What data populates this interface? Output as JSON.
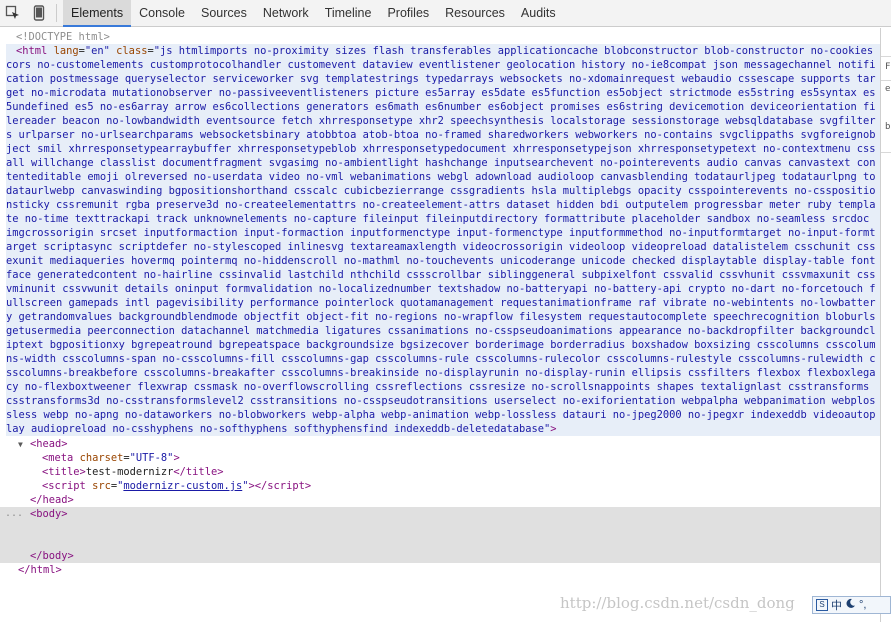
{
  "toolbar": {
    "inspect_icon": "inspect-element-icon",
    "device_icon": "device-mode-icon",
    "tabs": [
      "Elements",
      "Console",
      "Sources",
      "Network",
      "Timeline",
      "Profiles",
      "Resources",
      "Audits"
    ],
    "active_tab": "Elements"
  },
  "dom": {
    "doctype": "<!DOCTYPE html>",
    "html_tag": "html",
    "html_lang_attr": "lang",
    "html_lang_value": "en",
    "html_class_attr": "class",
    "html_class_value": "js htmlimports no-proximity sizes flash transferables applicationcache blobconstructor blob-constructor no-cookies cors no-customelements customprotocolhandler customevent dataview eventlistener geolocation history no-ie8compat json messagechannel notification postmessage queryselector serviceworker svg templatestrings typedarrays websockets no-xdomainrequest webaudio cssescape supports target no-microdata mutationobserver no-passiveeventlisteners picture es5array es5date es5function es5object strictmode es5string es5syntax es5undefined es5 no-es6array arrow es6collections generators es6math es6number es6object promises es6string devicemotion deviceorientation filereader beacon no-lowbandwidth eventsource fetch xhrresponsetype xhr2 speechsynthesis localstorage sessionstorage websqldatabase svgfilters urlparser no-urlsearchparams websocketsbinary atobbtoa atob-btoa no-framed sharedworkers webworkers no-contains svgclippaths svgforeignobject smil xhrresponsetypearraybuffer xhrresponsetypeblob xhrresponsetypedocument xhrresponsetypejson xhrresponsetypetext no-contextmenu cssall willchange classlist documentfragment svgasimg no-ambientlight hashchange inputsearchevent no-pointerevents audio canvas canvastext contenteditable emoji olreversed no-userdata video no-vml webanimations webgl adownload audioloop canvasblending todataurljpeg todataurlpng todataurlwebp canvaswinding bgpositionshorthand csscalc cubicbezierrange cssgradients hsla multiplebgs opacity csspointerevents no-csspositionsticky cssremunit rgba preserve3d no-createelementattrs no-createelement-attrs dataset hidden bdi outputelem progressbar meter ruby template no-time texttrackapi track unknownelements no-capture fileinput fileinputdirectory formattribute placeholder sandbox no-seamless srcdoc imgcrossorigin srcset inputformaction input-formaction inputformenctype input-formenctype inputformmethod no-inputformtarget no-input-formtarget scriptasync scriptdefer no-stylescoped inlinesvg textareamaxlength videocrossorigin videoloop videopreload datalistelem csschunit cssexunit mediaqueries hovermq pointermq no-hiddenscroll no-mathml no-touchevents unicoderange unicode checked displaytable display-table fontface generatedcontent no-hairline cssinvalid lastchild nthchild cssscrollbar siblinggeneral subpixelfont cssvalid cssvhunit cssvmaxunit cssvminunit cssvwunit details oninput formvalidation no-localizednumber textshadow no-batteryapi no-battery-api crypto no-dart no-forcetouch fullscreen gamepads intl pagevisibility performance pointerlock quotamanagement requestanimationframe raf vibrate no-webintents no-lowbattery getrandomvalues backgroundblendmode objectfit object-fit no-regions no-wrapflow filesystem requestautocomplete speechrecognition bloburls getusermedia peerconnection datachannel matchmedia ligatures cssanimations no-csspseudoanimations appearance no-backdropfilter backgroundcliptext bgpositionxy bgrepeatround bgrepeatspace backgroundsize bgsizecover borderimage borderradius boxshadow boxsizing csscolumns csscolumns-width csscolumns-span no-csscolumns-fill csscolumns-gap csscolumns-rule csscolumns-rulecolor csscolumns-rulestyle csscolumns-rulewidth csscolumns-breakbefore csscolumns-breakafter csscolumns-breakinside no-displayrunin no-display-runin ellipsis cssfilters flexbox flexboxlegacy no-flexboxtweener flexwrap cssmask no-overflowscrolling cssreflections cssresize no-scrollsnappoints shapes textalignlast csstransforms csstransforms3d no-csstransformslevel2 csstransitions no-csspseudotransitions userselect no-exiforientation webpalpha webpanimation webplossless webp no-apng no-dataworkers no-blobworkers webp-alpha webp-animation webp-lossless datauri no-jpeg2000 no-jpegxr indexeddb videoautoplay audiopreload no-csshyphens no-softhyphens softhyphensfind indexeddb-deletedatabase",
    "head_tag": "head",
    "meta_tag": "meta",
    "meta_attr": "charset",
    "meta_value": "UTF-8",
    "title_tag": "title",
    "title_text": "test-modernizr",
    "script_tag": "script",
    "script_attr": "src",
    "script_value": "modernizr-custom.js",
    "body_tag": "body",
    "ellipsis": "..."
  },
  "right_panel": {
    "marks": [
      "F",
      "e",
      "b"
    ]
  },
  "watermark": "http://blog.csdn.net/csdn_dong",
  "ime": {
    "input_mode": "中",
    "moon_icon": "moon-icon",
    "punct": "°,"
  },
  "colors": {
    "tag": "#881280",
    "attr": "#994500",
    "value": "#1a1aa6",
    "selected_bg": "#e7eef8",
    "active_tab_underline": "#3879d9"
  }
}
